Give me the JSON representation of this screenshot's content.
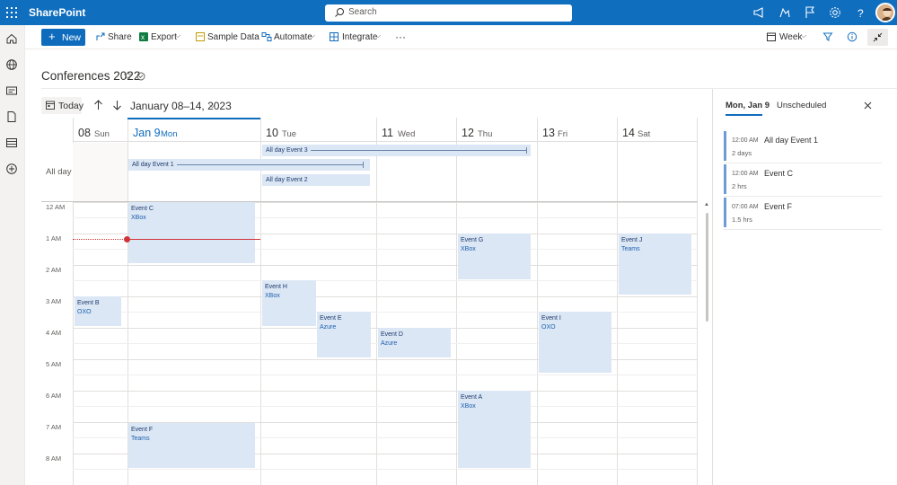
{
  "app": {
    "brand": "SharePoint"
  },
  "search": {
    "placeholder": "Search"
  },
  "commands": {
    "new": "New",
    "share": "Share",
    "export": "Export",
    "sample_data": "Sample Data",
    "automate": "Automate",
    "integrate": "Integrate",
    "more": "···",
    "view": "Week"
  },
  "page": {
    "title": "Conferences 2022"
  },
  "toolbar": {
    "today": "Today",
    "range": "January 08–14, 2023"
  },
  "calendar": {
    "allday_label": "All day",
    "days": [
      {
        "num": "08",
        "name": "Sun"
      },
      {
        "num": "Jan 9",
        "name": "Mon"
      },
      {
        "num": "10",
        "name": "Tue"
      },
      {
        "num": "11",
        "name": "Wed"
      },
      {
        "num": "12",
        "name": "Thu"
      },
      {
        "num": "13",
        "name": "Fri"
      },
      {
        "num": "14",
        "name": "Sat"
      }
    ],
    "hours": [
      "12 AM",
      "1 AM",
      "2 AM",
      "3 AM",
      "4 AM",
      "5 AM",
      "6 AM",
      "7 AM",
      "8 AM"
    ],
    "allday_events": [
      {
        "title": "All day Event 3"
      },
      {
        "title": "All day Event 1"
      },
      {
        "title": "All day Event 2"
      }
    ],
    "events": [
      {
        "title": "Event C",
        "sub": "XBox"
      },
      {
        "title": "Event B",
        "sub": "OXO"
      },
      {
        "title": "Event H",
        "sub": "XBox"
      },
      {
        "title": "Event E",
        "sub": "Azure"
      },
      {
        "title": "Event D",
        "sub": "Azure"
      },
      {
        "title": "Event G",
        "sub": "XBox"
      },
      {
        "title": "Event A",
        "sub": "XBox"
      },
      {
        "title": "Event I",
        "sub": "OXO"
      },
      {
        "title": "Event J",
        "sub": "Teams"
      },
      {
        "title": "Event F",
        "sub": "Teams"
      }
    ]
  },
  "panel": {
    "tabs": [
      "Mon, Jan 9",
      "Unscheduled"
    ],
    "items": [
      {
        "time": "12:00 AM",
        "name": "All day Event 1",
        "duration": "2 days"
      },
      {
        "time": "12:00 AM",
        "name": "Event C",
        "duration": "2 hrs"
      },
      {
        "time": "07:00 AM",
        "name": "Event F",
        "duration": "1.5 hrs"
      }
    ]
  },
  "colors": {
    "brand": "#106ebe",
    "accent": "#0f6cbd",
    "event_bg": "#dce7f5",
    "now_line": "#d13438"
  }
}
